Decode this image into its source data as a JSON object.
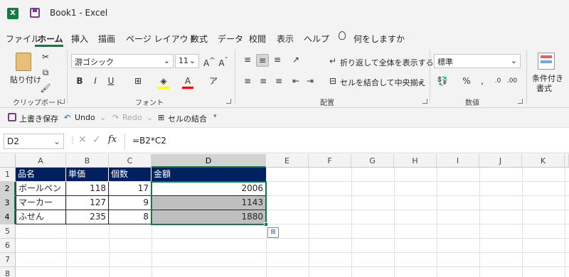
{
  "titlebar": {
    "app_icon": "excel-icon",
    "save_icon": "save-icon",
    "title": "Book1  -  Excel"
  },
  "menu": {
    "file": "ファイル",
    "home": "ホーム",
    "insert": "挿入",
    "draw": "描画",
    "page_layout": "ページ レイアウト",
    "formulas": "数式",
    "data": "データ",
    "review": "校閲",
    "view": "表示",
    "help": "ヘルプ",
    "tell_me": "何をしますか"
  },
  "ribbon": {
    "clipboard": {
      "paste": "貼り付け",
      "label": "クリップボード"
    },
    "font": {
      "name": "游ゴシック",
      "size": "11",
      "bold": "B",
      "italic": "I",
      "underline": "U",
      "label": "フォント"
    },
    "alignment": {
      "wrap": "折り返して全体を表示する",
      "merge": "セルを結合して中央揃え",
      "label": "配置"
    },
    "number": {
      "format": "標準",
      "percent": "%",
      "comma": ",",
      "label": "数値"
    },
    "styles": {
      "conditional": "条件付き",
      "conditional2": "書式"
    }
  },
  "qat": {
    "save": "上書き保存",
    "undo": "Undo",
    "redo": "Redo",
    "merge": "セルの結合"
  },
  "formula_bar": {
    "name_box": "D2",
    "fx": "fx",
    "formula": "=B2*C2"
  },
  "grid": {
    "columns": [
      "A",
      "B",
      "C",
      "D",
      "E",
      "F",
      "G",
      "H",
      "I",
      "J",
      "K"
    ],
    "rows": [
      "1",
      "2",
      "3",
      "4",
      "5",
      "6",
      "7",
      "8"
    ],
    "header": [
      "品名",
      "単価",
      "個数",
      "金額"
    ],
    "data": [
      [
        "ボールペン",
        "118",
        "17",
        "2006"
      ],
      [
        "マーカー",
        "127",
        "9",
        "1143"
      ],
      [
        "ふせん",
        "235",
        "8",
        "1880"
      ]
    ],
    "selected_cell": "D2",
    "header_fill": "#002060",
    "shade_fill": "#bfbfbf"
  }
}
